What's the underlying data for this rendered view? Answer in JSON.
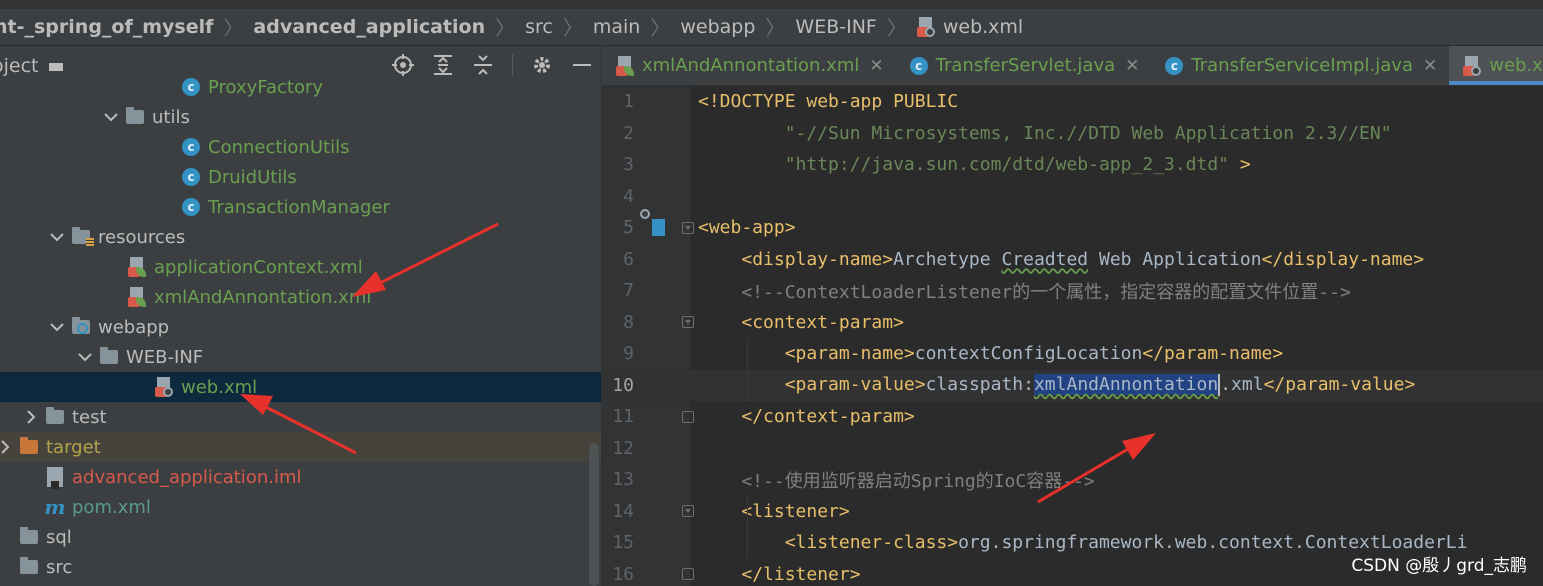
{
  "breadcrumb": {
    "items": [
      {
        "label": "nt-_spring_of_myself",
        "bold": true
      },
      {
        "label": "advanced_application",
        "bold": true
      },
      {
        "label": "src",
        "bold": false
      },
      {
        "label": "main",
        "bold": false
      },
      {
        "label": "webapp",
        "bold": false
      },
      {
        "label": "WEB-INF",
        "bold": false
      },
      {
        "label": "web.xml",
        "bold": false,
        "file": true
      }
    ]
  },
  "project_panel": {
    "title": "oject",
    "tools": [
      "locate-icon",
      "expand-all-icon",
      "collapse-all-icon",
      "settings-gear-icon",
      "hide-icon"
    ]
  },
  "tree": [
    {
      "label": "ProxyFactory",
      "icon": "class-icon",
      "indent": 160,
      "arrow": "",
      "color": "green",
      "clipped": true
    },
    {
      "label": "utils",
      "icon": "package-icon",
      "indent": 104,
      "arrow": "down"
    },
    {
      "label": "ConnectionUtils",
      "icon": "class-icon",
      "indent": 160,
      "arrow": "",
      "color": "green"
    },
    {
      "label": "DruidUtils",
      "icon": "class-icon",
      "indent": 160,
      "arrow": "",
      "color": "green"
    },
    {
      "label": "TransactionManager",
      "icon": "class-icon",
      "indent": 160,
      "arrow": "",
      "color": "green"
    },
    {
      "label": "resources",
      "icon": "resources-folder-icon",
      "indent": 50,
      "arrow": "down"
    },
    {
      "label": "applicationContext.xml",
      "icon": "spring-xml-icon",
      "indent": 106,
      "arrow": "",
      "color": "green"
    },
    {
      "label": "xmlAndAnnontation.xml",
      "icon": "spring-xml-icon",
      "indent": 106,
      "arrow": "",
      "color": "green"
    },
    {
      "label": "webapp",
      "icon": "web-folder-icon",
      "indent": 50,
      "arrow": "down"
    },
    {
      "label": "WEB-INF",
      "icon": "folder-icon",
      "indent": 78,
      "arrow": "down"
    },
    {
      "label": "web.xml",
      "icon": "web-xml-icon",
      "indent": 133,
      "arrow": "",
      "color": "green",
      "selected": true
    },
    {
      "label": "test",
      "icon": "folder-icon",
      "indent": 24,
      "arrow": "right"
    },
    {
      "label": "target",
      "icon": "excluded-folder-icon",
      "indent": -2,
      "arrow": "right",
      "color": "yellow",
      "excluded": true
    },
    {
      "label": "advanced_application.iml",
      "icon": "iml-file-icon",
      "indent": 24,
      "arrow": "",
      "color": "red"
    },
    {
      "label": "pom.xml",
      "icon": "maven-icon",
      "indent": 24,
      "arrow": "",
      "color": "teal"
    },
    {
      "label": "sql",
      "icon": "folder-icon",
      "indent": -2,
      "arrow": ""
    },
    {
      "label": "src",
      "icon": "folder-icon",
      "indent": -2,
      "arrow": ""
    }
  ],
  "editor_tabs": [
    {
      "label": "xmlAndAnnontation.xml",
      "icon": "spring-xml-icon",
      "active": false
    },
    {
      "label": "TransferServlet.java",
      "icon": "class-icon",
      "active": false
    },
    {
      "label": "TransferServiceImpl.java",
      "icon": "class-icon",
      "active": false
    },
    {
      "label": "web.xml",
      "icon": "web-xml-icon",
      "active": true
    }
  ],
  "code": {
    "current_line": 10,
    "lines": [
      {
        "n": "1",
        "parts": [
          [
            "t-tag",
            "<!DOCTYPE web-app PUBLIC"
          ]
        ]
      },
      {
        "n": "2",
        "parts": [
          [
            "t-str",
            "        \"-//Sun Microsystems, Inc.//DTD Web Application 2.3//EN\""
          ]
        ]
      },
      {
        "n": "3",
        "parts": [
          [
            "t-str",
            "        \"http://java.sun.com/dtd/web-app_2_3.dtd\""
          ],
          [
            "t-tag",
            " >"
          ]
        ]
      },
      {
        "n": "4",
        "parts": []
      },
      {
        "n": "5",
        "parts": [
          [
            "t-tag",
            "<web-app>"
          ]
        ]
      },
      {
        "n": "6",
        "parts": [
          [
            "t-text",
            "    "
          ],
          [
            "t-tag",
            "<display-name>"
          ],
          [
            "t-text",
            "Archetype "
          ],
          [
            "t-text t-typo",
            "Creadted"
          ],
          [
            "t-text",
            " Web Application"
          ],
          [
            "t-tag",
            "</display-name>"
          ]
        ]
      },
      {
        "n": "7",
        "parts": [
          [
            "t-comm",
            "    <!--ContextLoaderListener的一个属性，指定容器的配置文件位置-->"
          ]
        ]
      },
      {
        "n": "8",
        "parts": [
          [
            "t-text",
            "    "
          ],
          [
            "t-tag",
            "<context-param>"
          ]
        ]
      },
      {
        "n": "9",
        "parts": [
          [
            "t-text",
            "        "
          ],
          [
            "t-tag",
            "<param-name>"
          ],
          [
            "t-text",
            "contextConfigLocation"
          ],
          [
            "t-tag",
            "</param-name>"
          ]
        ]
      },
      {
        "n": "10",
        "parts": [
          [
            "t-text",
            "        "
          ],
          [
            "t-tag",
            "<param-value>"
          ],
          [
            "t-text",
            "classpath:"
          ],
          [
            "t-hl t-typo",
            "xmlAndAnnontation"
          ],
          [
            "caret",
            ""
          ],
          [
            "t-text",
            ".xml"
          ],
          [
            "t-tag",
            "</param-value>"
          ]
        ]
      },
      {
        "n": "11",
        "parts": [
          [
            "t-text",
            "    "
          ],
          [
            "t-tag",
            "</context-param>"
          ]
        ]
      },
      {
        "n": "12",
        "parts": []
      },
      {
        "n": "13",
        "parts": [
          [
            "t-comm",
            "    <!--使用监听器启动Spring的IoC容器-->"
          ]
        ]
      },
      {
        "n": "14",
        "parts": [
          [
            "t-text",
            "    "
          ],
          [
            "t-tag",
            "<listener>"
          ]
        ]
      },
      {
        "n": "15",
        "parts": [
          [
            "t-text",
            "        "
          ],
          [
            "t-tag",
            "<listener-class>"
          ],
          [
            "t-text",
            "org.springframework.web.context.ContextLoaderLi"
          ]
        ]
      },
      {
        "n": "16",
        "parts": [
          [
            "t-text",
            "    "
          ],
          [
            "t-tag",
            "</listener>"
          ]
        ]
      }
    ]
  },
  "watermark": "CSDN @殷丿grd_志鹏",
  "colors": {
    "annotation_arrow": "#e8312a",
    "selection": "#0d293e",
    "active_tab_underline": "#4a88c7"
  }
}
